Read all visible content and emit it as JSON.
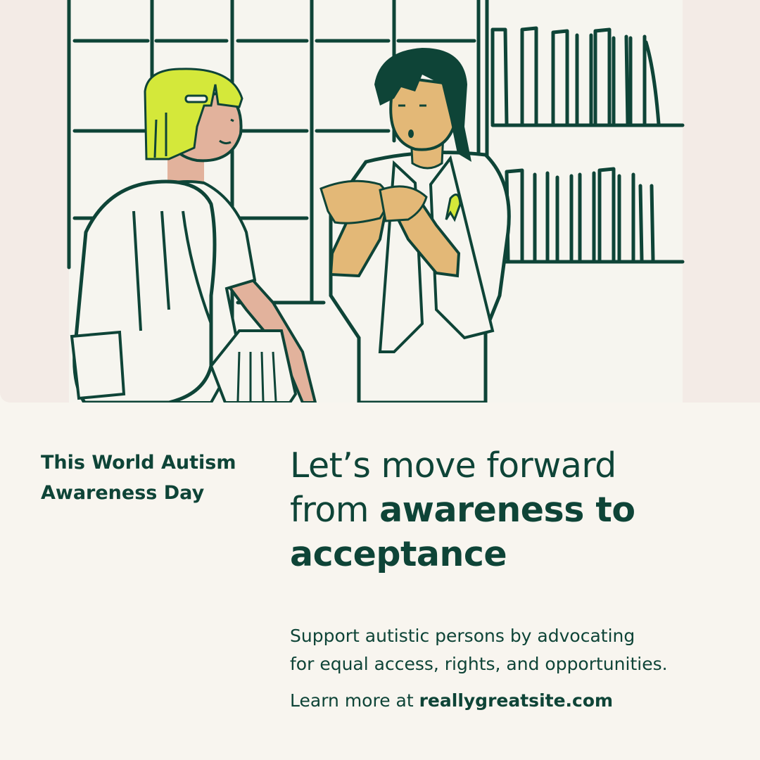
{
  "illustration": {
    "description_icon": "two-people-signing-illustration-icon",
    "colors": {
      "background": "#f3ebe6",
      "ink": "#0e4437",
      "cabinet": "#f6f5ef",
      "hair_yellow": "#d4e83a",
      "skin_light": "#e2b29c",
      "skin_tan": "#e3b877",
      "ribbon": "#d4e83a"
    }
  },
  "eyebrow": {
    "line1": "This World Autism",
    "line2": "Awareness Day"
  },
  "headline": {
    "part1": "Let’s move forward",
    "part2": "from ",
    "part3_bold": "awareness to",
    "part4_bold": "acceptance"
  },
  "body": {
    "line1": "Support autistic persons by advocating",
    "line2": "for equal access, rights, and opportunities."
  },
  "learn_more": {
    "prefix": "Learn more at ",
    "site": "reallygreatsite.com"
  }
}
